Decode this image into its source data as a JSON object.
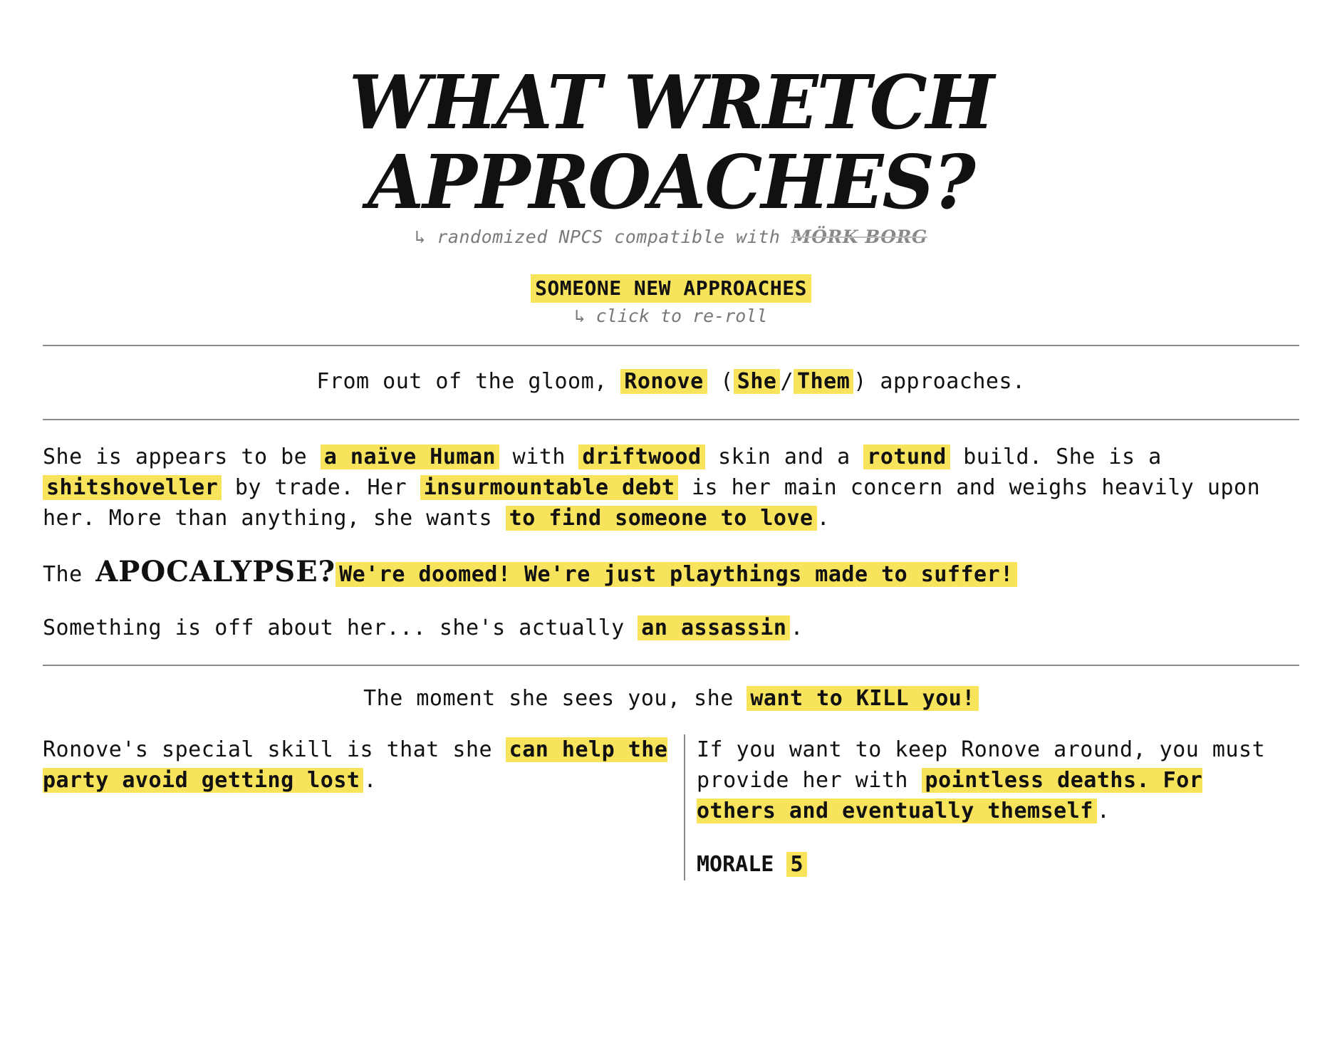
{
  "header": {
    "title": "WHAT WRETCH APPROACHES?",
    "subtitle_prefix": "↳ randomized NPCS compatible with",
    "subtitle_brand": "MÖRK BORG"
  },
  "reroll": {
    "button_label": "SOMEONE NEW APPROACHES",
    "hint": "↳ click to re-roll"
  },
  "intro": {
    "pre": "From out of the gloom,",
    "name": "Ronove",
    "open_paren": "(",
    "pronoun_a": "She",
    "slash": "/",
    "pronoun_b": "Them",
    "close": ") approaches."
  },
  "description": {
    "t1": "She is appears to be",
    "trait": "a naïve  Human",
    "t2": "with",
    "skin": "driftwood",
    "t3": "skin and a",
    "build": "rotund",
    "t4": "build. She is a",
    "trade": "shitshoveller",
    "t5": "by trade. Her",
    "concern": "insurmountable debt",
    "t6": "is her main concern and weighs heavily upon her. More than anything, she wants",
    "want": "to find someone to love",
    "t7": "."
  },
  "apocalypse": {
    "pre": "The",
    "word": "APOCALYPSE?",
    "opinion": "We're doomed! We're just playthings made to suffer!"
  },
  "secret": {
    "text": "Something is off about her... she's actually",
    "value": "an assassin",
    "end": "."
  },
  "reaction": {
    "text": "The moment she sees you, she",
    "value": "want to KILL you!"
  },
  "skill": {
    "text": "Ronove's special skill is that she",
    "value": "can help the party avoid getting lost",
    "end": "."
  },
  "keep": {
    "text": "If you want to keep Ronove around, you must provide her with",
    "value": "pointless deaths. For others and eventually themself",
    "end": "."
  },
  "morale": {
    "label": "MORALE",
    "value": "5"
  },
  "colors": {
    "highlight": "#f8e45c",
    "rule": "#8a8a8a",
    "muted_text": "#777777"
  }
}
